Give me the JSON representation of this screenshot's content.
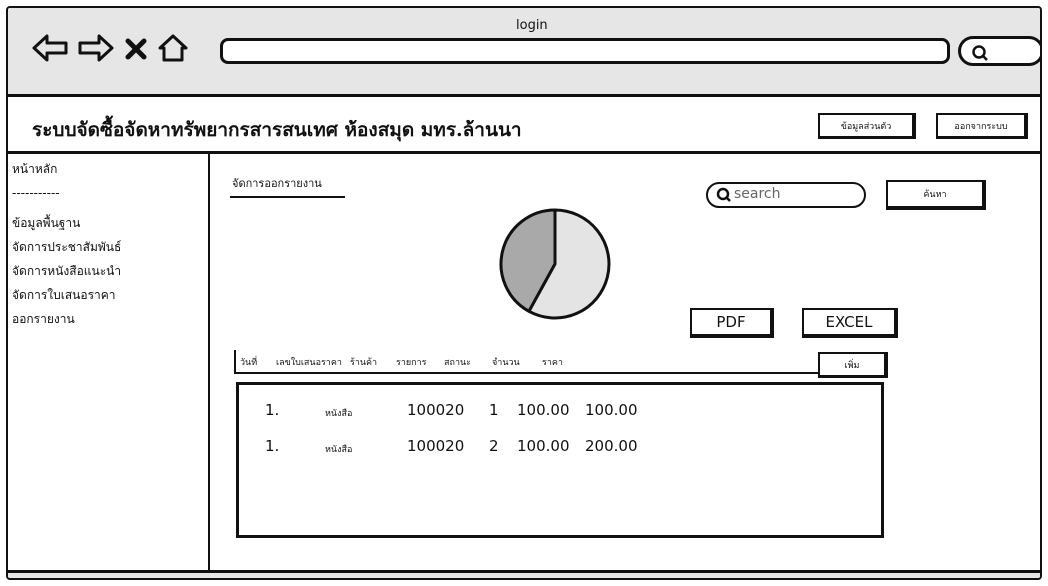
{
  "window": {
    "title": "login"
  },
  "nav": {
    "icons": [
      "back-arrow-icon",
      "forward-arrow-icon",
      "close-icon",
      "home-icon",
      "search-icon"
    ]
  },
  "header": {
    "title": "ระบบจัดซื้อจัดหาทรัพยากรสารสนเทศ ห้องสมุด มทร.ล้านนา",
    "profile_button": "ข้อมูลส่วนตัว",
    "logout_button": "ออกจากระบบ"
  },
  "sidebar": {
    "items": [
      "หน้าหลัก",
      "-----------",
      "ข้อมูลพื้นฐาน",
      "จัดการประชาสัมพันธ์",
      "จัดการหนังสือแนะนำ",
      "จัดการใบเสนอราคา",
      "ออกรายงาน"
    ]
  },
  "main": {
    "section_title": "จัดการออกรายงาน",
    "search": {
      "placeholder": "search"
    },
    "find_button": "ค้นหา",
    "pdf_button": "PDF",
    "excel_button": "EXCEL",
    "add_button": "เพิ่ม",
    "table": {
      "columns": [
        "วันที่",
        "เลขใบเสนอราคา",
        "ร้านค้า",
        "รายการ",
        "สถานะ",
        "จำนวน",
        "ราคา"
      ],
      "rows": [
        {
          "no": "1.",
          "item": "หนังสือ",
          "code": "100020",
          "qty": "1",
          "unit_price": "100.00",
          "total": "100.00"
        },
        {
          "no": "1.",
          "item": "หนังสือ",
          "code": "100020",
          "qty": "2",
          "unit_price": "100.00",
          "total": "200.00"
        }
      ]
    }
  },
  "chart_data": {
    "type": "pie",
    "values": [
      0.42,
      0.58
    ],
    "colors": [
      "#a9a9a9",
      "#e4e4e4"
    ]
  }
}
